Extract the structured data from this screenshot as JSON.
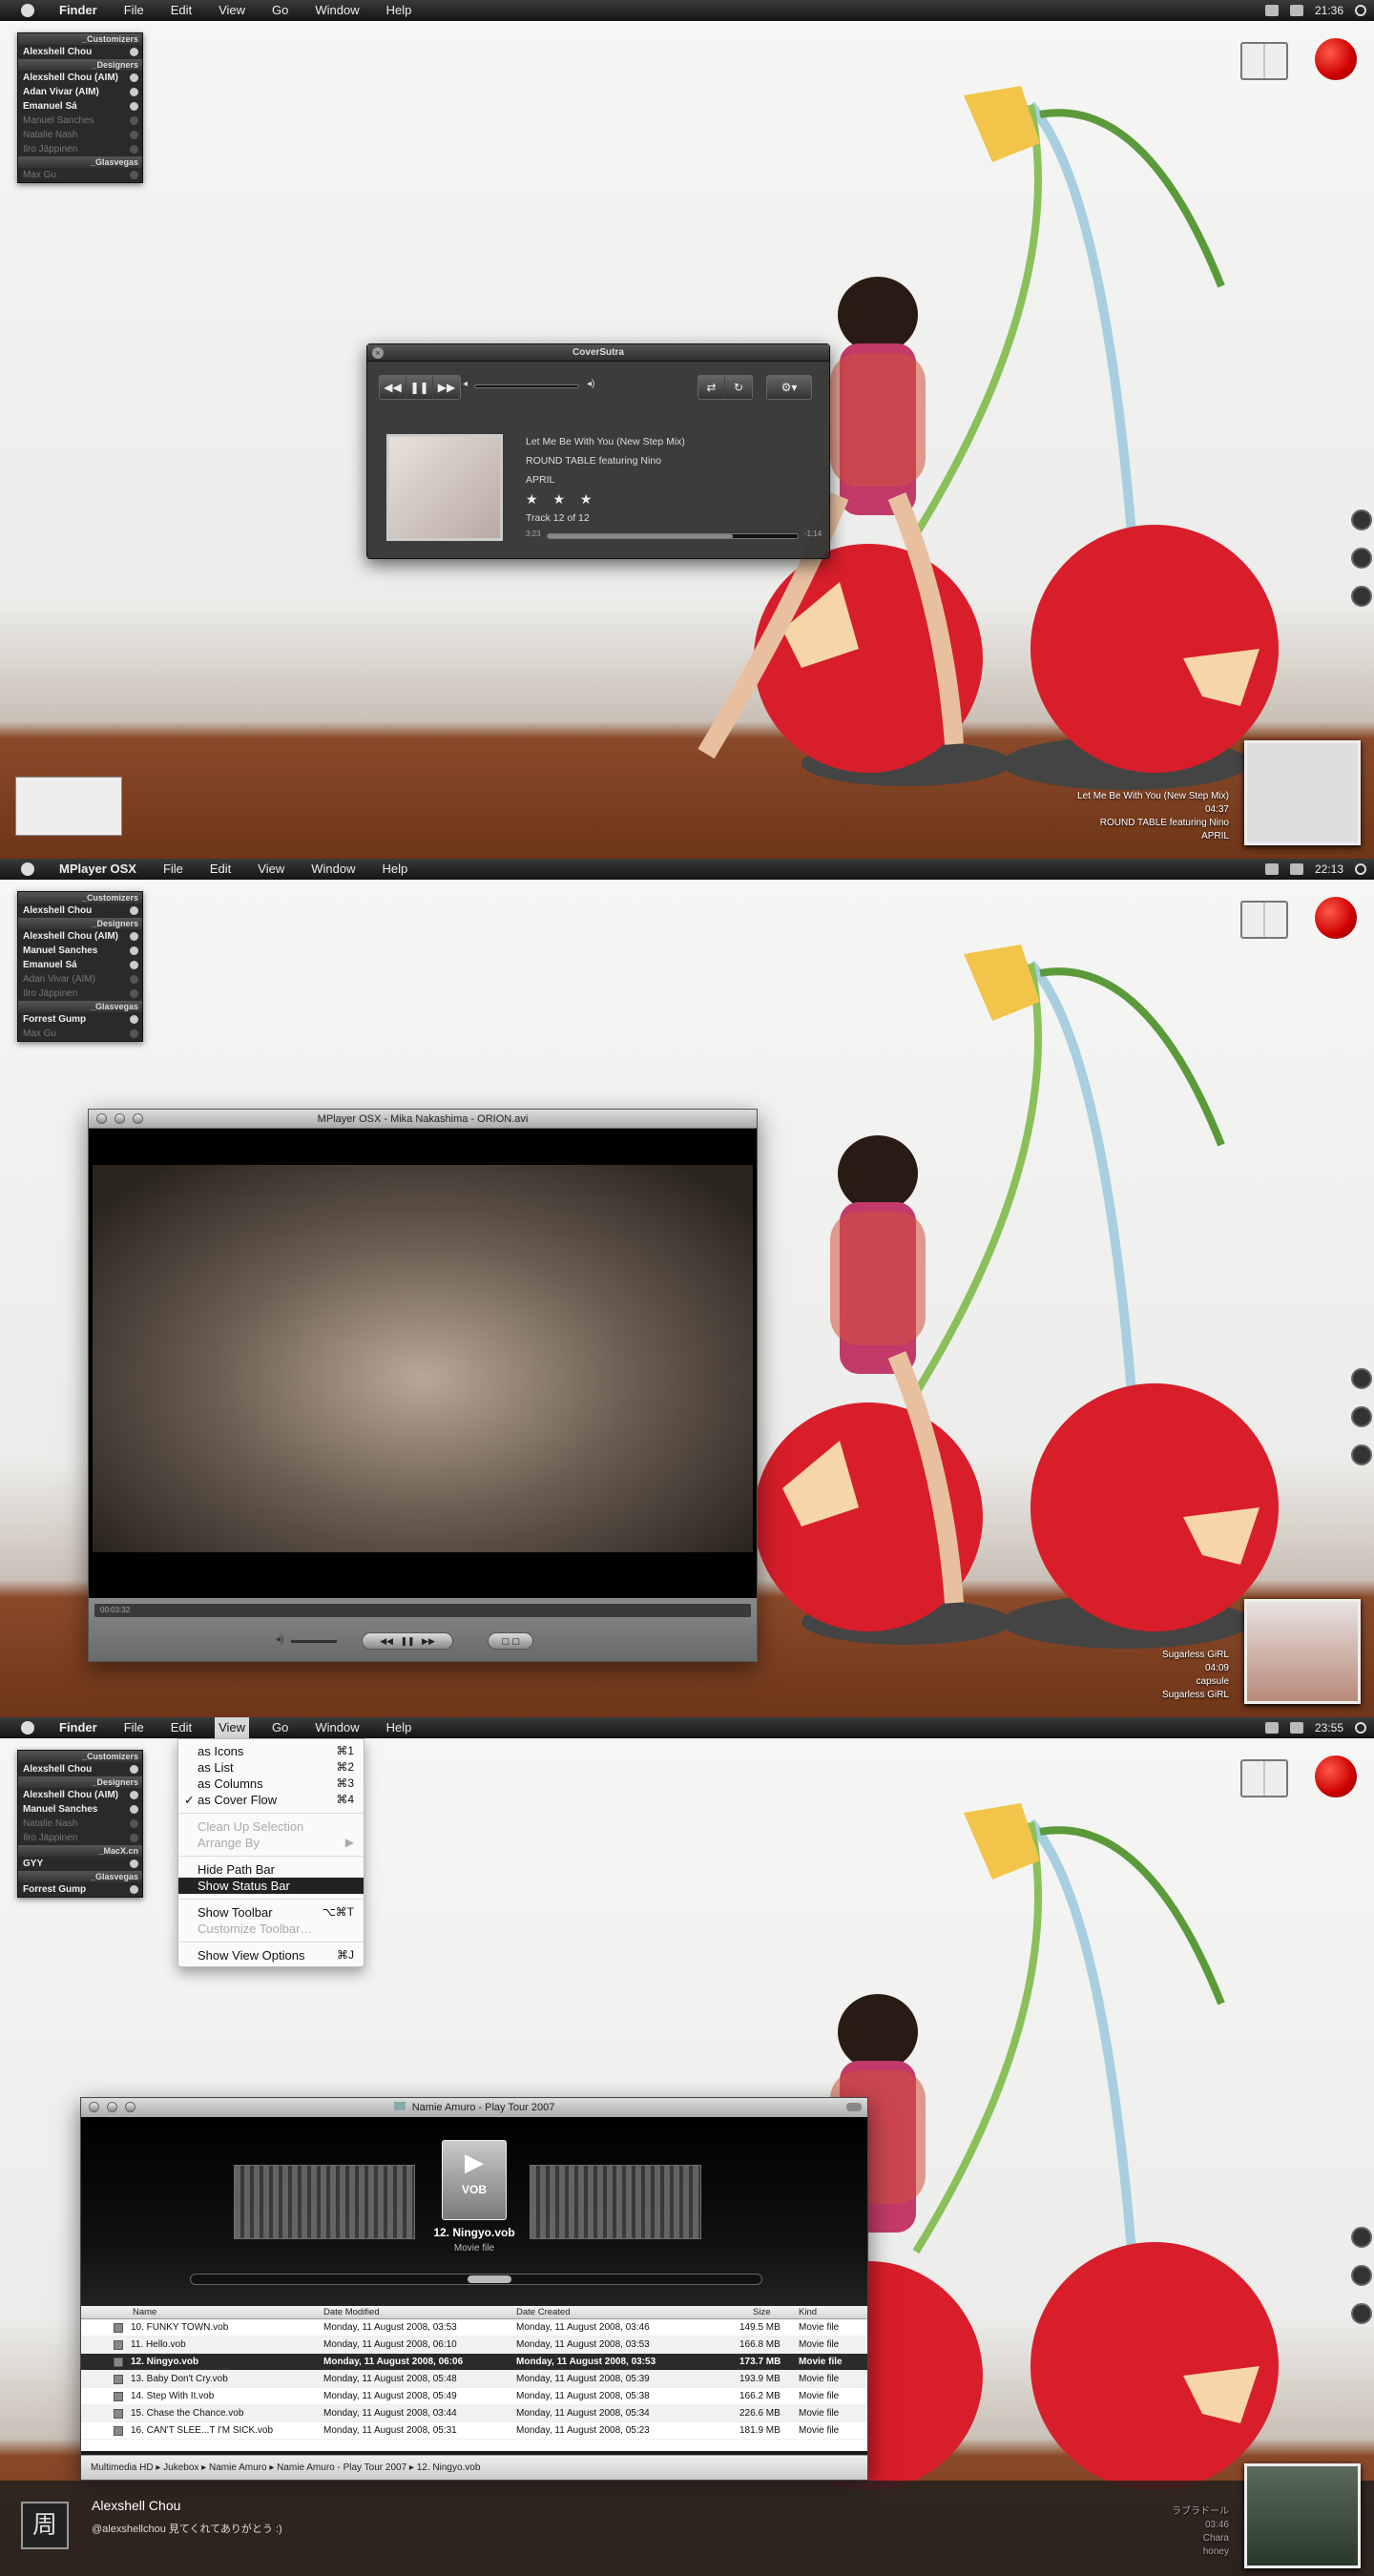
{
  "panels": [
    {
      "menubar": {
        "app": "Finder",
        "items": [
          "File",
          "Edit",
          "View",
          "Go",
          "Window",
          "Help"
        ],
        "time": "21:36"
      },
      "buddylist": [
        {
          "group": "_Customizers"
        },
        {
          "name": "Alexshell Chou",
          "dim": false
        },
        {
          "group": "_Designers"
        },
        {
          "name": "Alexshell Chou (AIM)",
          "dim": false
        },
        {
          "name": "Adan Vivar (AIM)",
          "dim": false
        },
        {
          "name": "Emanuel Sá",
          "dim": false
        },
        {
          "name": "Manuel Sanches",
          "dim": true
        },
        {
          "name": "Natalie Nash",
          "dim": true
        },
        {
          "name": "Ilro Jäppinen",
          "dim": true
        },
        {
          "group": "_Glasvegas"
        },
        {
          "name": "Max Gu",
          "dim": true
        }
      ],
      "nowplaying": {
        "title": "Let Me Be With You (New Step Mix)",
        "time": "04:37",
        "artist": "ROUND TABLE featuring Nino",
        "album": "APRIL"
      }
    },
    {
      "menubar": {
        "app": "MPlayer OSX",
        "items": [
          "File",
          "Edit",
          "View",
          "Window",
          "Help"
        ],
        "time": "22:13"
      },
      "buddylist": [
        {
          "group": "_Customizers"
        },
        {
          "name": "Alexshell Chou",
          "dim": false
        },
        {
          "group": "_Designers"
        },
        {
          "name": "Alexshell Chou (AIM)",
          "dim": false
        },
        {
          "name": "Manuel Sanches",
          "dim": false
        },
        {
          "name": "Emanuel Sá",
          "dim": false
        },
        {
          "name": "Adan Vivar (AIM)",
          "dim": true
        },
        {
          "name": "Ilro Jäppinen",
          "dim": true
        },
        {
          "group": "_Glasvegas"
        },
        {
          "name": "Forrest Gump",
          "dim": false
        },
        {
          "name": "Max Gu",
          "dim": true
        }
      ],
      "nowplaying": {
        "title": "Sugarless GiRL",
        "time": "04:09",
        "artist": "capsule",
        "album": "Sugarless GiRL"
      }
    },
    {
      "menubar": {
        "app": "Finder",
        "items": [
          "File",
          "Edit",
          "View",
          "Go",
          "Window",
          "Help"
        ],
        "time": "23:55"
      },
      "buddylist": [
        {
          "group": "_Customizers"
        },
        {
          "name": "Alexshell Chou",
          "dim": false
        },
        {
          "group": "_Designers"
        },
        {
          "name": "Alexshell Chou (AIM)",
          "dim": false
        },
        {
          "name": "Manuel Sanches",
          "dim": false
        },
        {
          "name": "Natalie Nash",
          "dim": true
        },
        {
          "name": "Ilro Jäppinen",
          "dim": true
        },
        {
          "group": "_MacX.cn"
        },
        {
          "name": "GYY",
          "dim": false
        },
        {
          "group": "_Glasvegas"
        },
        {
          "name": "Forrest Gump",
          "dim": false
        }
      ],
      "nowplaying": {
        "title": "ラブラドール",
        "time": "03:46",
        "artist": "Chara",
        "album": "honey"
      }
    }
  ],
  "coversutra": {
    "title": "CoverSutra",
    "track": "Let Me Be With You (New Step Mix)",
    "artist": "ROUND TABLE featuring Nino",
    "album": "APRIL",
    "stars": "★ ★ ★",
    "track_no": "Track 12 of 12",
    "elapsed": "3:23",
    "remaining": "-1:14",
    "progress": 0.74
  },
  "mplayer": {
    "title": "MPlayer OSX - Mika Nakashima - ORION.avi",
    "timecode": "00:03:32"
  },
  "view_menu": {
    "items": [
      {
        "label": "as Icons",
        "key": "⌘1",
        "state": ""
      },
      {
        "label": "as List",
        "key": "⌘2",
        "state": ""
      },
      {
        "label": "as Columns",
        "key": "⌘3",
        "state": ""
      },
      {
        "label": "as Cover Flow",
        "key": "⌘4",
        "state": "checked"
      },
      {
        "sep": true
      },
      {
        "label": "Clean Up Selection",
        "key": "",
        "state": "disabled"
      },
      {
        "label": "Arrange By",
        "key": "▶",
        "state": "disabled"
      },
      {
        "sep": true
      },
      {
        "label": "Hide Path Bar",
        "key": "",
        "state": ""
      },
      {
        "label": "Show Status Bar",
        "key": "",
        "state": "highlighted"
      },
      {
        "sep": true
      },
      {
        "label": "Show Toolbar",
        "key": "⌥⌘T",
        "state": ""
      },
      {
        "label": "Customize Toolbar…",
        "key": "",
        "state": "disabled"
      },
      {
        "sep": true
      },
      {
        "label": "Show View Options",
        "key": "⌘J",
        "state": ""
      }
    ]
  },
  "finder": {
    "title": "Namie Amuro - Play Tour 2007",
    "selected_name": "12. Ningyo.vob",
    "selected_kind": "Movie file",
    "vob_label": "VOB",
    "columns": [
      "Name",
      "Date Modified",
      "Date Created",
      "Size",
      "Kind"
    ],
    "rows": [
      {
        "name": "10. FUNKY TOWN.vob",
        "mod": "Monday, 11 August 2008, 03:53",
        "created": "Monday, 11 August 2008, 03:46",
        "size": "149.5 MB",
        "kind": "Movie file"
      },
      {
        "name": "11. Hello.vob",
        "mod": "Monday, 11 August 2008, 06:10",
        "created": "Monday, 11 August 2008, 03:53",
        "size": "166.8 MB",
        "kind": "Movie file"
      },
      {
        "name": "12. Ningyo.vob",
        "mod": "Monday, 11 August 2008, 06:06",
        "created": "Monday, 11 August 2008, 03:53",
        "size": "173.7 MB",
        "kind": "Movie file"
      },
      {
        "name": "13. Baby Don't Cry.vob",
        "mod": "Monday, 11 August 2008, 05:48",
        "created": "Monday, 11 August 2008, 05:39",
        "size": "193.9 MB",
        "kind": "Movie file"
      },
      {
        "name": "14. Step With It.vob",
        "mod": "Monday, 11 August 2008, 05:49",
        "created": "Monday, 11 August 2008, 05:38",
        "size": "166.2 MB",
        "kind": "Movie file"
      },
      {
        "name": "15. Chase the Chance.vob",
        "mod": "Monday, 11 August 2008, 03:44",
        "created": "Monday, 11 August 2008, 05:34",
        "size": "226.6 MB",
        "kind": "Movie file"
      },
      {
        "name": "16. CAN'T SLEE...T I'M SICK.vob",
        "mod": "Monday, 11 August 2008, 05:31",
        "created": "Monday, 11 August 2008, 05:23",
        "size": "181.9 MB",
        "kind": "Movie file"
      }
    ],
    "path": [
      "Multimedia HD",
      "Jukebox",
      "Namie Amuro",
      "Namie Amuro - Play Tour 2007",
      "12. Ningyo.vob"
    ]
  },
  "twitter": {
    "avatar": "周",
    "name": "Alexshell Chou",
    "text": "@alexshellchou 見てくれてありがとう :)"
  }
}
